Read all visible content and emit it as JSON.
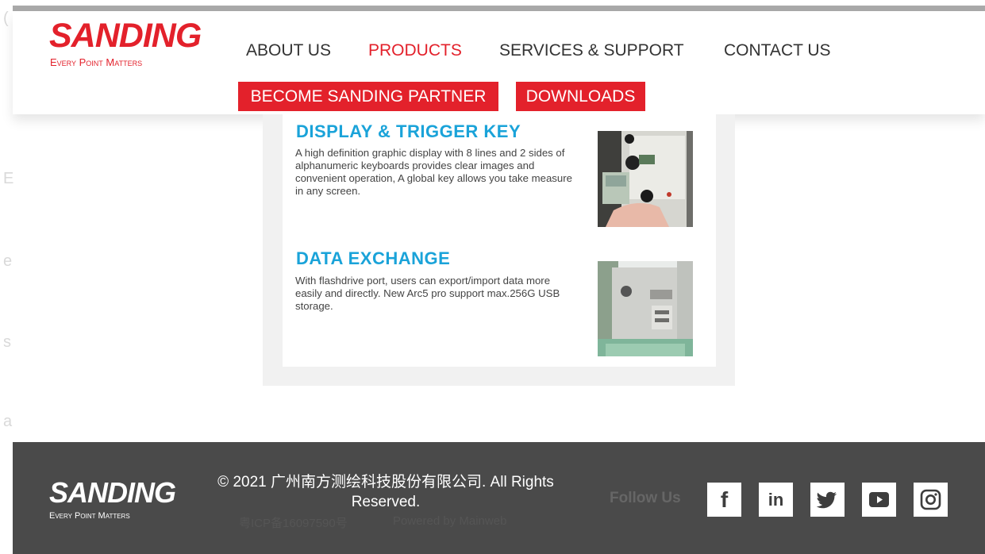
{
  "brand": {
    "name": "SANDING",
    "tagline": "Every Point Matters",
    "primary_color": "#e3212b",
    "accent_color": "#1aa3d9"
  },
  "nav": {
    "links": [
      {
        "label": "ABOUT US",
        "active": false
      },
      {
        "label": "PRODUCTS",
        "active": true
      },
      {
        "label": "SERVICES & SUPPORT",
        "active": false
      },
      {
        "label": "CONTACT US",
        "active": false
      }
    ],
    "buttons": [
      {
        "label": "BECOME SANDING PARTNER"
      },
      {
        "label": "DOWNLOADS"
      }
    ]
  },
  "features": [
    {
      "title": "DISPLAY & TRIGGER KEY",
      "description": "A high definition graphic display with 8 lines and 2 sides of alphanumeric keyboards provides clear images and convenient operation, A global key allows you take measure in any screen.",
      "image_icon": "total-station-keypad-photo"
    },
    {
      "title": "DATA EXCHANGE",
      "description": "With flashdrive port, users can export/import data more easily and directly. New Arc5 pro support max.256G USB storage.",
      "image_icon": "total-station-usb-port-photo"
    }
  ],
  "footer": {
    "copyright_line1": "© 2021 广州南方测绘科技股份有限公司. All Rights",
    "copyright_line2": "Reserved.",
    "icp": "粤ICP备16097590号",
    "powered_by": "Powered by Mainweb",
    "follow_label": "Follow Us",
    "social": [
      {
        "name": "facebook-icon",
        "glyph": "f"
      },
      {
        "name": "linkedin-icon",
        "glyph": "in"
      },
      {
        "name": "twitter-icon",
        "glyph": ""
      },
      {
        "name": "youtube-icon",
        "glyph": ""
      },
      {
        "name": "instagram-icon",
        "glyph": ""
      }
    ]
  }
}
